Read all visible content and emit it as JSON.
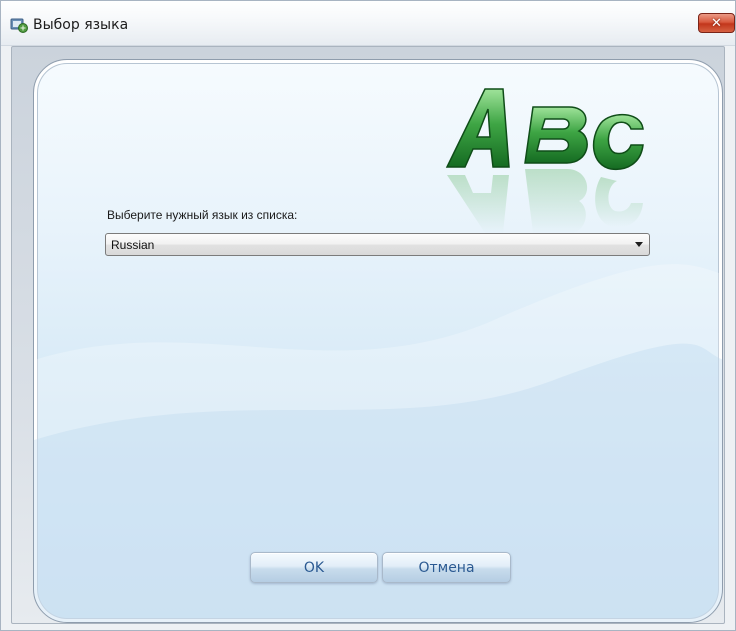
{
  "window": {
    "title": "Выбор языка",
    "icons": {
      "app": "language-app-icon",
      "close": "close-icon"
    },
    "close_symbol": "✕"
  },
  "logo": {
    "letters": "ABC",
    "icon": "abc-logo-icon",
    "color": "#2e8b3a"
  },
  "form": {
    "prompt_label": "Выберите нужный язык из списка:",
    "language_select": {
      "selected_value": "Russian",
      "icon": "chevron-down-icon"
    }
  },
  "buttons": {
    "ok_label": "OK",
    "cancel_label": "Отмена"
  },
  "colors": {
    "panel_top": "#f6fbfe",
    "panel_bottom": "#c9e0f2",
    "button_text": "#2b5a92",
    "close_button": "#c2361b"
  }
}
